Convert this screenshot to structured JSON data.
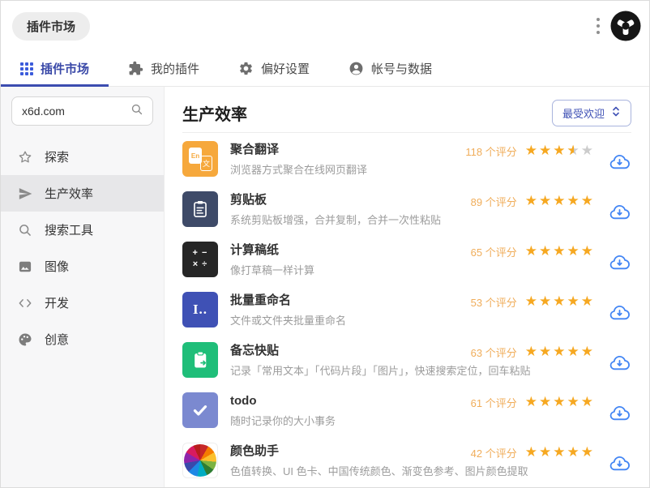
{
  "window": {
    "title_pill": "插件市场"
  },
  "tabs": [
    {
      "label": "插件市场",
      "icon": "grid-icon",
      "active": true
    },
    {
      "label": "我的插件",
      "icon": "puzzle-icon",
      "active": false
    },
    {
      "label": "偏好设置",
      "icon": "gear-icon",
      "active": false
    },
    {
      "label": "帐号与数据",
      "icon": "person-icon",
      "active": false
    }
  ],
  "sidebar": {
    "search": {
      "value": "x6d.com",
      "icon": "search-icon"
    },
    "items": [
      {
        "label": "探索",
        "icon": "star-icon",
        "selected": false
      },
      {
        "label": "生产效率",
        "icon": "paper-plane-icon",
        "selected": true
      },
      {
        "label": "搜索工具",
        "icon": "search-icon",
        "selected": false
      },
      {
        "label": "图像",
        "icon": "image-icon",
        "selected": false
      },
      {
        "label": "开发",
        "icon": "code-icon",
        "selected": false
      },
      {
        "label": "创意",
        "icon": "palette-icon",
        "selected": false
      }
    ]
  },
  "main": {
    "heading": "生产效率",
    "sort": {
      "label": "最受欢迎"
    },
    "apps": [
      {
        "name": "聚合翻译",
        "desc": "浏览器方式聚合在线网页翻译",
        "ratings": "118 个评分",
        "stars": 3.5,
        "icon": "translate",
        "icon_bg": "#f6a83c",
        "icon_front": "En",
        "icon_back": "文"
      },
      {
        "name": "剪贴板",
        "desc": "系统剪贴板增强，合并复制，合并一次性粘贴",
        "ratings": "89 个评分",
        "stars": 5,
        "icon": "clipboard",
        "icon_bg": "#3e4a68"
      },
      {
        "name": "计算稿纸",
        "desc": "像打草稿一样计算",
        "ratings": "65 个评分",
        "stars": 5,
        "icon": "calculator",
        "icon_bg": "#262626",
        "icon_line1": "+ −",
        "icon_line2": "× ÷"
      },
      {
        "name": "批量重命名",
        "desc": "文件或文件夹批量重命名",
        "ratings": "53 个评分",
        "stars": 5,
        "icon": "rename",
        "icon_bg": "#3f51b5",
        "icon_text": "I.."
      },
      {
        "name": "备忘快贴",
        "desc": "记录「常用文本」「代码片段」「图片」，快速搜索定位，回车粘贴",
        "ratings": "63 个评分",
        "stars": 5,
        "icon": "memo-clipboard",
        "icon_bg": "#1fbe79"
      },
      {
        "name": "todo",
        "desc": "随时记录你的大小事务",
        "ratings": "61 个评分",
        "stars": 5,
        "icon": "checkmark",
        "icon_bg": "#7b89d0"
      },
      {
        "name": "颜色助手",
        "desc": "色值转换、UI 色卡、中国传统颜色、渐变色参考、图片颜色提取",
        "ratings": "42 个评分",
        "stars": 5,
        "icon": "color-wheel",
        "icon_bg": "#ffffff"
      }
    ]
  },
  "colors": {
    "accent_blue": "#3c4db0",
    "tab_icon_blue": "#3b5bdb",
    "star_filled": "#f6a821",
    "star_empty": "#cccccc",
    "rating_text": "#f0ad5a",
    "download_blue": "#4285f4",
    "sidebar_bg": "#f7f7f8",
    "selected_item_bg": "#e7e7e9"
  }
}
